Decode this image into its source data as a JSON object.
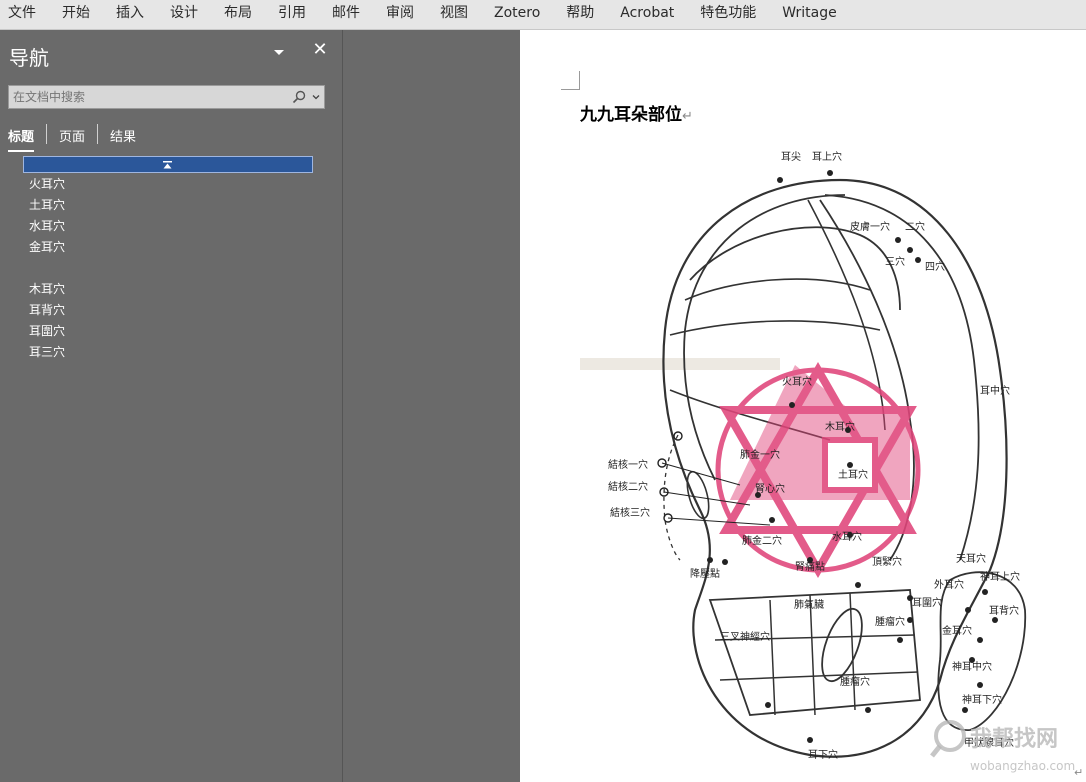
{
  "menu": {
    "tabs": [
      "文件",
      "开始",
      "插入",
      "设计",
      "布局",
      "引用",
      "邮件",
      "审阅",
      "视图",
      "Zotero",
      "帮助",
      "Acrobat",
      "特色功能",
      "Writage"
    ]
  },
  "nav": {
    "title": "导航",
    "search_placeholder": "在文档中搜索",
    "tabs": {
      "headings": "标题",
      "pages": "页面",
      "results": "结果"
    },
    "headings": [
      "火耳穴",
      "土耳穴",
      "水耳穴",
      "金耳穴",
      "木耳穴",
      "耳背穴",
      "耳圍穴",
      "耳三穴"
    ]
  },
  "document": {
    "title": "九九耳朵部位",
    "figure_labels": {
      "top1": "耳尖",
      "top2": "耳上穴",
      "skin": "皮膚一穴",
      "three": "三穴",
      "four": "四穴",
      "two": "二穴",
      "fire": "火耳穴",
      "wood": "木耳穴",
      "earth": "土耳穴",
      "water": "水耳穴",
      "lung1": "肺金一穴",
      "heart": "腎心穴",
      "lung2": "肺金二穴",
      "kid": "腎痛點",
      "nod1": "結核一穴",
      "nod2": "結核二穴",
      "nod3": "結核三穴",
      "bp": "降壓點",
      "neck": "頂緊穴",
      "mid": "耳中穴",
      "lungqi": "肺氣臟",
      "tumor1": "腫瘤穴",
      "tumor2": "腫瘤穴",
      "nerve": "三叉神經穴",
      "round": "耳圍穴",
      "bottom": "耳下穴",
      "back_top": "天耳穴",
      "back_up": "神耳上穴",
      "back_out": "外耳穴",
      "back_back": "耳背穴",
      "back_gold": "金耳穴",
      "back_mid": "神耳中穴",
      "back_low": "神耳下穴",
      "back_bottom": "甲狀腺耳穴"
    },
    "watermark_cn": "我帮找网",
    "watermark_url": "wobangzhao.com"
  },
  "colors": {
    "accent": "#2b579a",
    "stamp": "#e0457a"
  }
}
